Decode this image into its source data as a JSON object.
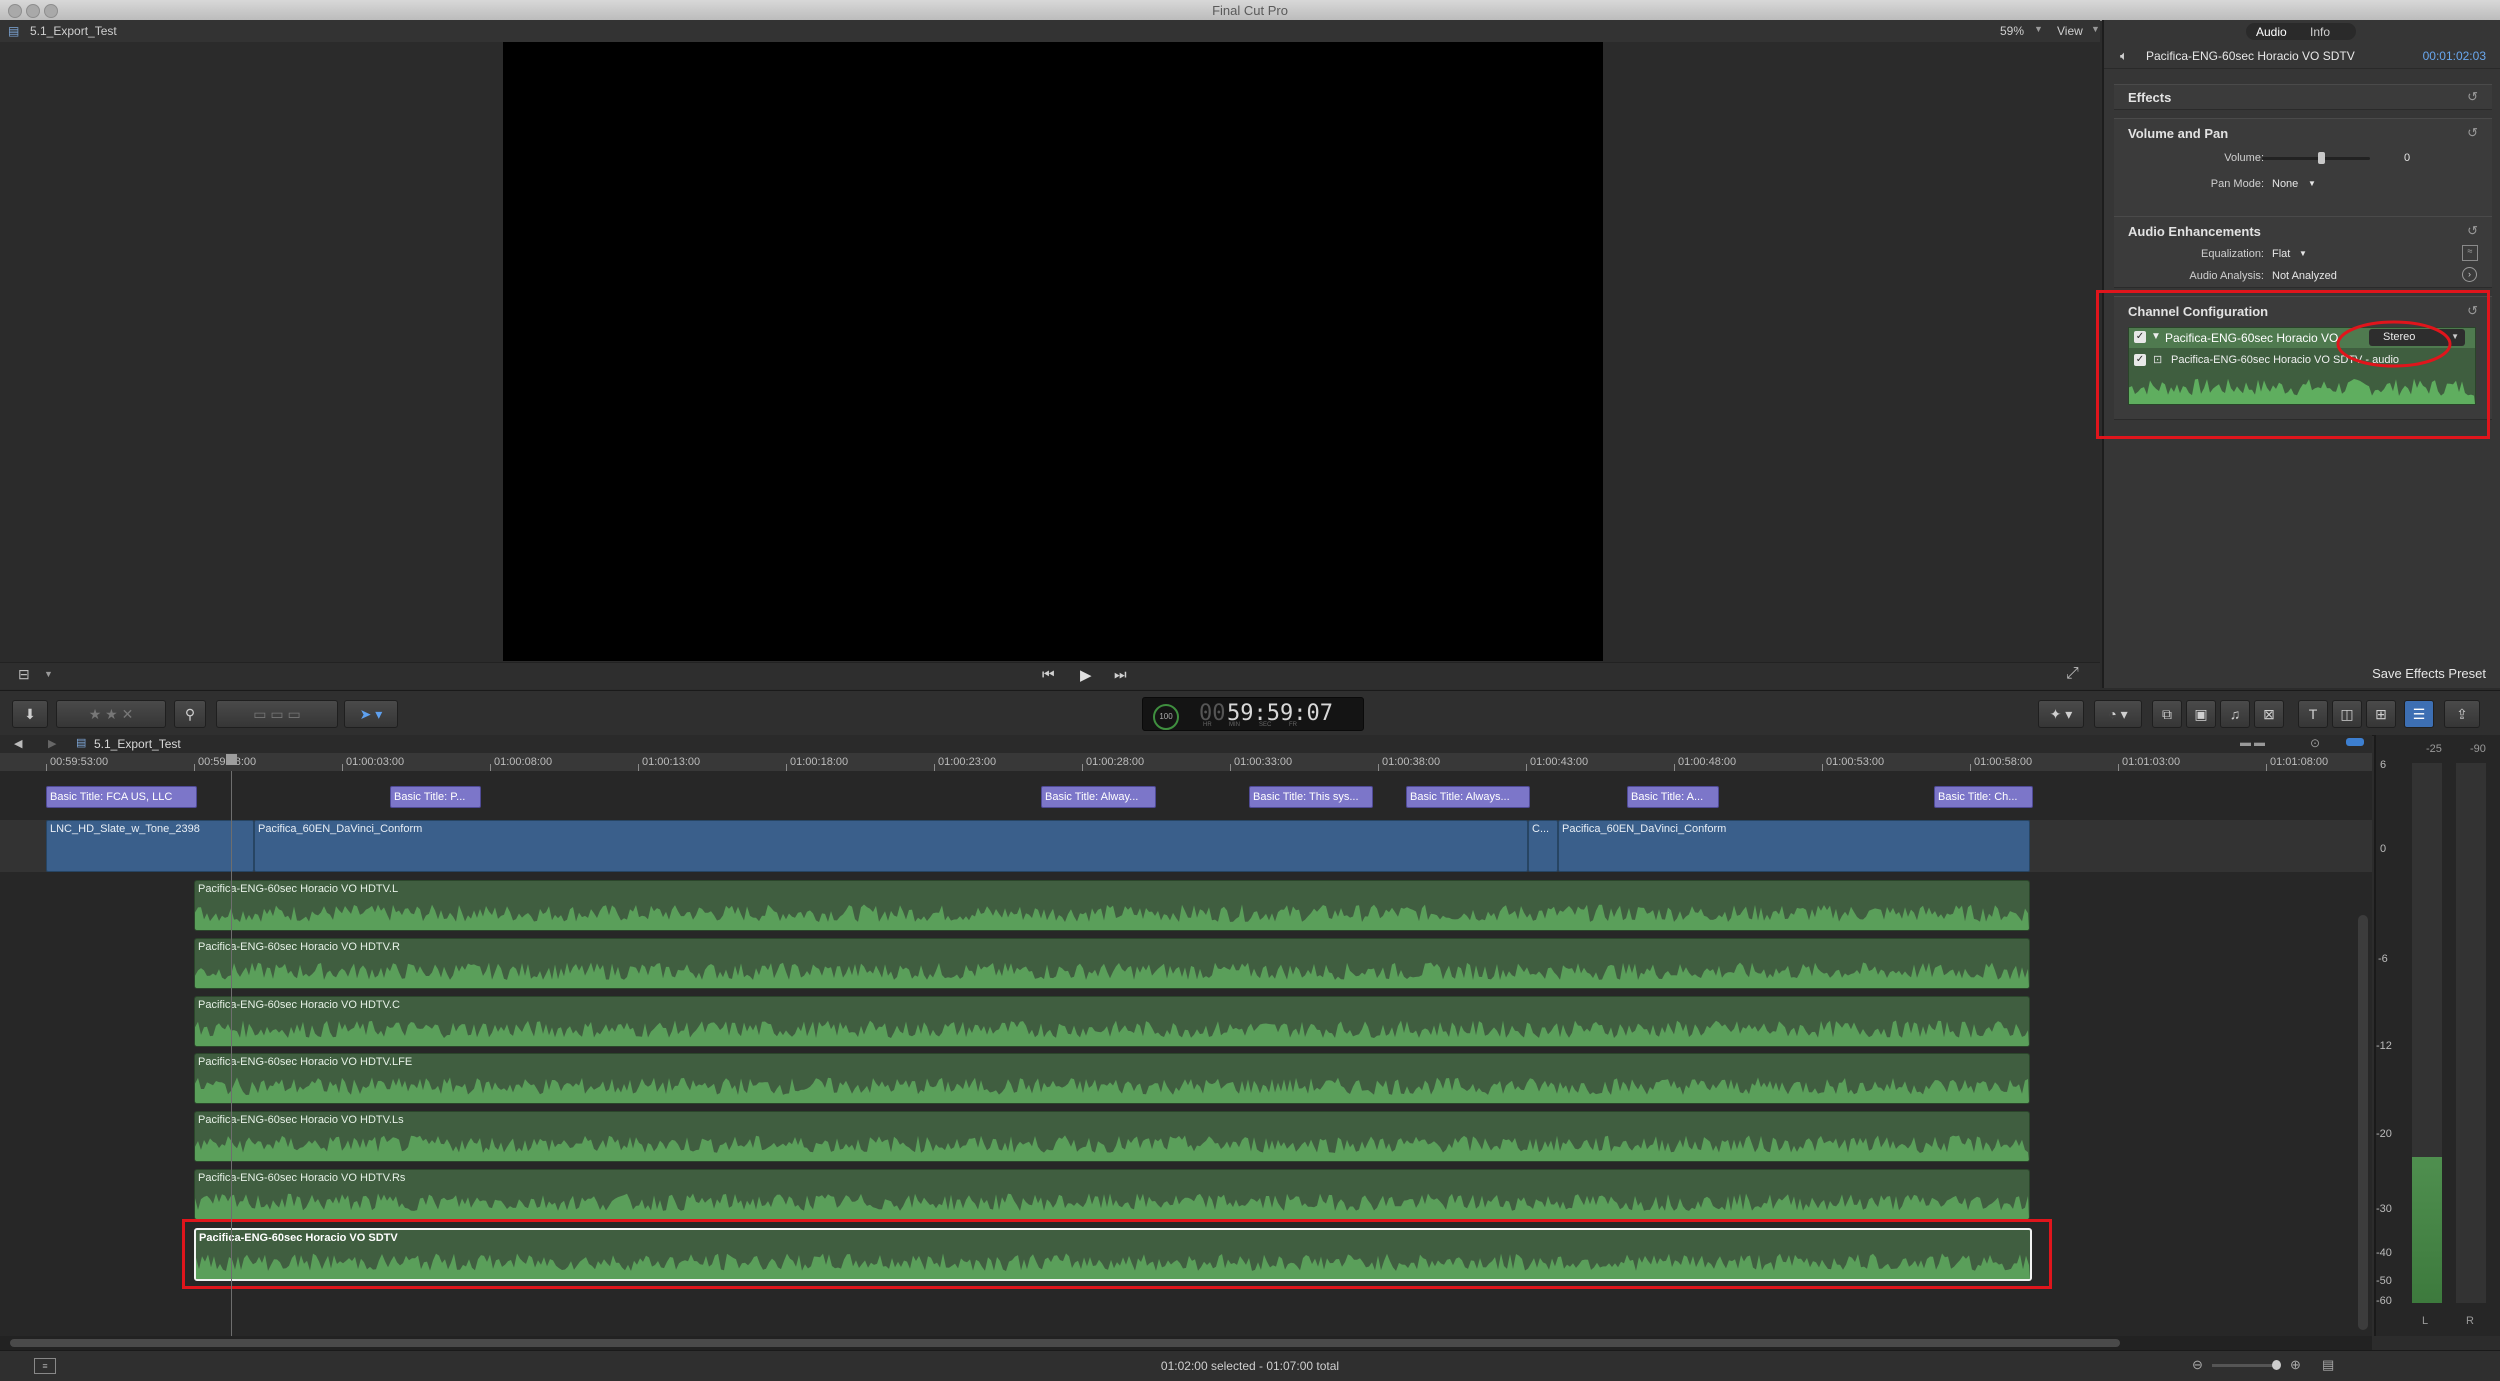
{
  "app": {
    "title": "Final Cut Pro"
  },
  "viewer": {
    "project_name": "5.1_Export_Test",
    "zoom": "59%",
    "view_menu": "View"
  },
  "inspector": {
    "tabs": [
      "Audio",
      "Info"
    ],
    "active_tab": "Audio",
    "clip_name": "Pacifica-ENG-60sec Horacio VO SDTV",
    "duration": "00:01:02:03",
    "effects_label": "Effects",
    "volume_pan": {
      "title": "Volume and Pan",
      "volume_label": "Volume:",
      "volume_value": "0",
      "volume_level": 0.55,
      "pan_mode_label": "Pan Mode:",
      "pan_mode_value": "None"
    },
    "audio_enhancements": {
      "title": "Audio Enhancements",
      "eq_label": "Equalization:",
      "eq_value": "Flat",
      "analysis_label": "Audio Analysis:",
      "analysis_value": "Not Analyzed"
    },
    "channel_config": {
      "title": "Channel Configuration",
      "clip_label": "Pacifica-ENG-60sec Horacio VO",
      "mode": "Stereo",
      "component_label": "Pacifica-ENG-60sec Horacio VO SDTV - audio"
    },
    "save_preset": "Save Effects Preset"
  },
  "toolbar": {
    "timecode": "59:59:07",
    "timecode_prefix": "00",
    "timecode_units": [
      "HR",
      "MIN",
      "SEC",
      "FR"
    ],
    "render_percent": "100"
  },
  "timeline": {
    "project_name": "5.1_Export_Test",
    "ruler_ticks": [
      "00:59:53:00",
      "00:59:58:00",
      "01:00:03:00",
      "01:00:08:00",
      "01:00:13:00",
      "01:00:18:00",
      "01:00:23:00",
      "01:00:28:00",
      "01:00:33:00",
      "01:00:38:00",
      "01:00:43:00",
      "01:00:48:00",
      "01:00:53:00",
      "01:00:58:00",
      "01:01:03:00",
      "01:01:08:00"
    ],
    "titles": [
      "Basic Title: FCA US, LLC",
      "Basic Title: P...",
      "Basic Title: Alway...",
      "Basic Title: This sys...",
      "Basic Title: Always...",
      "Basic Title: A...",
      "Basic Title: Ch..."
    ],
    "video_clips": [
      "LNC_HD_Slate_w_Tone_2398",
      "Pacifica_60EN_DaVinci_Conform",
      "C...",
      "Pacifica_60EN_DaVinci_Conform"
    ],
    "audio_clips": [
      "Pacifica-ENG-60sec Horacio VO HDTV.L",
      "Pacifica-ENG-60sec Horacio VO HDTV.R",
      "Pacifica-ENG-60sec Horacio VO HDTV.C",
      "Pacifica-ENG-60sec Horacio VO HDTV.LFE",
      "Pacifica-ENG-60sec Horacio VO HDTV.Ls",
      "Pacifica-ENG-60sec Horacio VO HDTV.Rs",
      "Pacifica-ENG-60sec Horacio VO SDTV"
    ]
  },
  "meter": {
    "scale": [
      "6",
      "0",
      "-6",
      "-12",
      "-20",
      "-30",
      "-40",
      "-50",
      "-60"
    ],
    "peaks": [
      "-25",
      "-90"
    ],
    "channels": [
      "L",
      "R"
    ],
    "left_level_db": "-25"
  },
  "status": {
    "selection": "01:02:00 selected - 01:07:00 total"
  },
  "colors": {
    "title_clip": "#7c76c9",
    "video_clip": "#3a5f8b",
    "audio_clip": "#405e40",
    "highlight": "#e0151c"
  }
}
